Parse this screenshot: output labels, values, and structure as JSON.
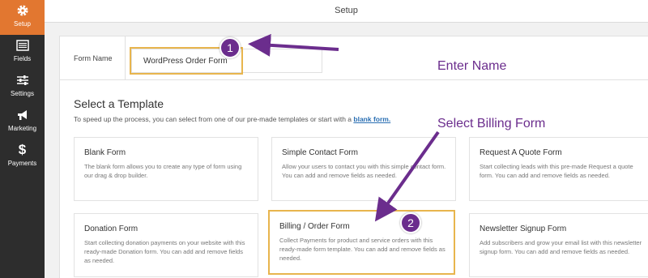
{
  "sidebar": {
    "items": [
      {
        "label": "Setup",
        "icon": "gear-icon",
        "active": true
      },
      {
        "label": "Fields",
        "icon": "fields-icon",
        "active": false
      },
      {
        "label": "Settings",
        "icon": "sliders-icon",
        "active": false
      },
      {
        "label": "Marketing",
        "icon": "megaphone-icon",
        "active": false
      },
      {
        "label": "Payments",
        "icon": "dollar-icon",
        "active": false
      }
    ]
  },
  "topbar": {
    "title": "Setup"
  },
  "form_name": {
    "label": "Form Name",
    "value": "WordPress Order Form"
  },
  "templates": {
    "heading": "Select a Template",
    "description": "To speed up the process, you can select from one of our pre-made templates or start with a",
    "blank_link": "blank form.",
    "cards": [
      {
        "title": "Blank Form",
        "desc": "The blank form allows you to create any type of form using our drag & drop builder."
      },
      {
        "title": "Simple Contact Form",
        "desc": "Allow your users to contact you with this simple contact form. You can add and remove fields as needed."
      },
      {
        "title": "Request A Quote Form",
        "desc": "Start collecting leads with this pre-made Request a quote form. You can add and remove fields as needed."
      },
      {
        "title": "Donation Form",
        "desc": "Start collecting donation payments on your website with this ready-made Donation form. You can add and remove fields as needed."
      },
      {
        "title": "Billing / Order Form",
        "desc": "Collect Payments for product and service orders with this ready-made form template. You can add and remove fields as needed."
      },
      {
        "title": "Newsletter Signup Form",
        "desc": "Add subscribers and grow your email list with this newsletter signup form. You can add and remove fields as needed."
      }
    ]
  },
  "annotations": {
    "step1": "1",
    "step2": "2",
    "enter_name": "Enter Name",
    "select_billing": "Select Billing Form"
  },
  "colors": {
    "accent": "#e27730",
    "sidebar": "#2d2d2d",
    "highlight": "#e8b54d",
    "annotation": "#6b2d8d",
    "link": "#2a6fb3"
  }
}
